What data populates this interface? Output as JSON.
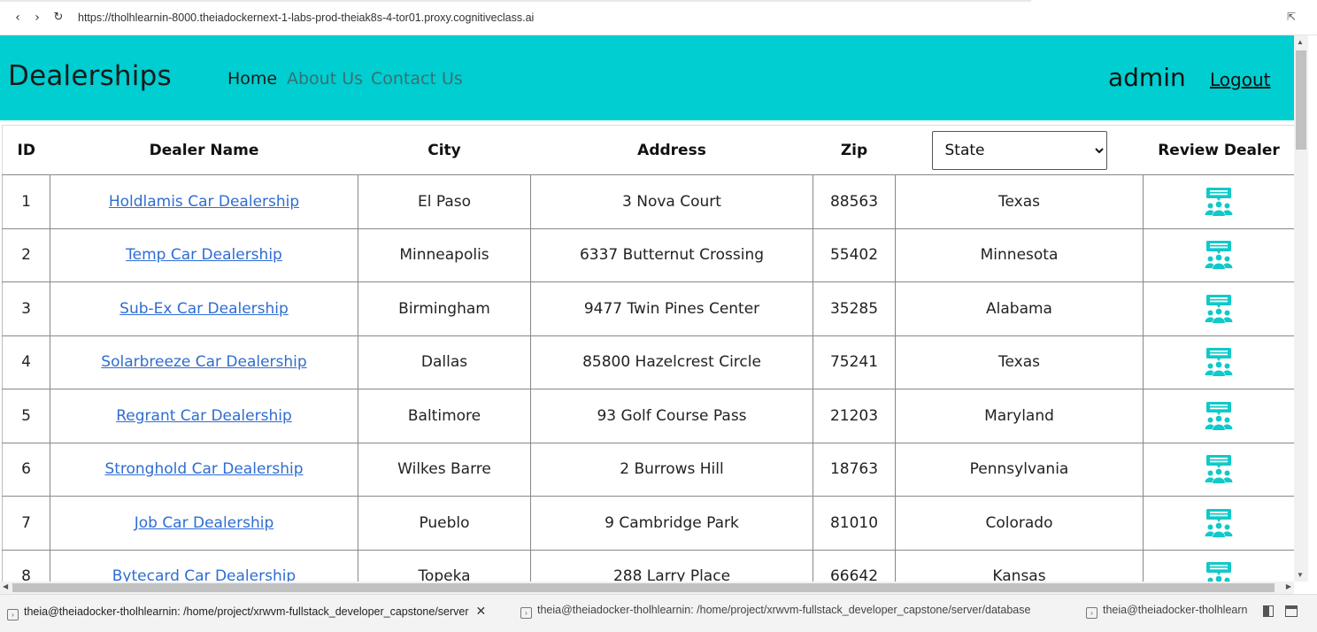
{
  "browser": {
    "url": "https://tholhlearnin-8000.theiadockernext-1-labs-prod-theiak8s-4-tor01.proxy.cognitiveclass.ai"
  },
  "navbar": {
    "brand": "Dealerships",
    "links": [
      "Home",
      "About Us",
      "Contact Us"
    ],
    "user": "admin",
    "logout": "Logout",
    "background": "#00ced1"
  },
  "table": {
    "headers": {
      "id": "ID",
      "name": "Dealer Name",
      "city": "City",
      "address": "Address",
      "zip": "Zip",
      "review": "Review Dealer"
    },
    "state_filter": {
      "selected": "State"
    },
    "review_icon": "review-people-icon",
    "rows": [
      {
        "id": "1",
        "name": "Holdlamis Car Dealership",
        "city": "El Paso",
        "address": "3 Nova Court",
        "zip": "88563",
        "state": "Texas"
      },
      {
        "id": "2",
        "name": "Temp Car Dealership",
        "city": "Minneapolis",
        "address": "6337 Butternut Crossing",
        "zip": "55402",
        "state": "Minnesota"
      },
      {
        "id": "3",
        "name": "Sub-Ex Car Dealership",
        "city": "Birmingham",
        "address": "9477 Twin Pines Center",
        "zip": "35285",
        "state": "Alabama"
      },
      {
        "id": "4",
        "name": "Solarbreeze Car Dealership",
        "city": "Dallas",
        "address": "85800 Hazelcrest Circle",
        "zip": "75241",
        "state": "Texas"
      },
      {
        "id": "5",
        "name": "Regrant Car Dealership",
        "city": "Baltimore",
        "address": "93 Golf Course Pass",
        "zip": "21203",
        "state": "Maryland"
      },
      {
        "id": "6",
        "name": "Stronghold Car Dealership",
        "city": "Wilkes Barre",
        "address": "2 Burrows Hill",
        "zip": "18763",
        "state": "Pennsylvania"
      },
      {
        "id": "7",
        "name": "Job Car Dealership",
        "city": "Pueblo",
        "address": "9 Cambridge Park",
        "zip": "81010",
        "state": "Colorado"
      },
      {
        "id": "8",
        "name": "Bytecard Car Dealership",
        "city": "Topeka",
        "address": "288 Larry Place",
        "zip": "66642",
        "state": "Kansas"
      }
    ]
  },
  "terminal_tabs": [
    "theia@theiadocker-tholhlearnin: /home/project/xrwvm-fullstack_developer_capstone/server",
    "theia@theiadocker-tholhlearnin: /home/project/xrwvm-fullstack_developer_capstone/server/database",
    "theia@theiadocker-tholhlearn"
  ]
}
